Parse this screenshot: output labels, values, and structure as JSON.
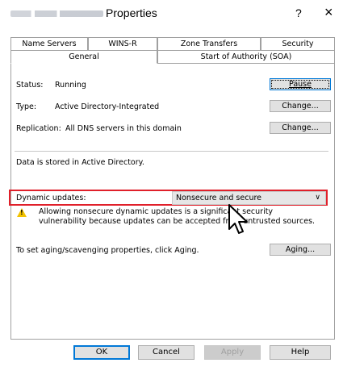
{
  "window": {
    "title": "Properties",
    "help_label": "?",
    "close_label": "×"
  },
  "tabs": {
    "back": [
      {
        "label": "Name Servers"
      },
      {
        "label": "WINS-R"
      },
      {
        "label": "Zone Transfers"
      },
      {
        "label": "Security"
      }
    ],
    "front": [
      {
        "label": "General",
        "selected": true
      },
      {
        "label": "Start of Authority (SOA)"
      }
    ]
  },
  "general": {
    "status_label": "Status:",
    "status_value": "Running",
    "type_label": "Type:",
    "type_value": "Active Directory-Integrated",
    "replication_label": "Replication:",
    "replication_value": "All DNS servers in this domain",
    "pause_button": "Pause",
    "change_type_button": "Change...",
    "change_replication_button": "Change...",
    "storage_note": "Data is stored in Active Directory.",
    "dynamic_updates_label": "Dynamic updates:",
    "dynamic_updates_value": "Nonsecure and secure",
    "warning_line1": "Allowing nonsecure dynamic updates is a significant security",
    "warning_line2": "vulnerability because updates can be accepted from untrusted sources.",
    "aging_text": "To set aging/scavenging properties, click Aging.",
    "aging_button": "Aging..."
  },
  "buttons": {
    "ok": "OK",
    "cancel": "Cancel",
    "apply": "Apply",
    "help": "Help"
  },
  "colors": {
    "highlight": "#e0202a",
    "focus": "#0078d7",
    "warning": "#f2c200"
  }
}
